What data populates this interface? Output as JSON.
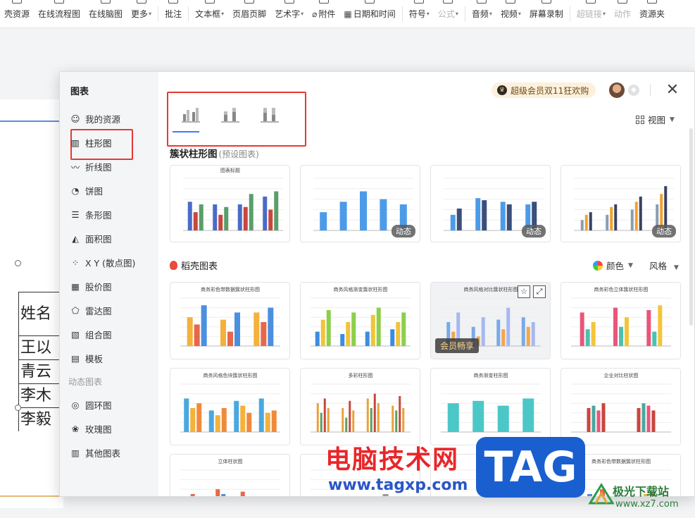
{
  "toolbar": {
    "items": [
      {
        "label": "壳资源",
        "caret": false,
        "disabled": false
      },
      {
        "label": "在线流程图",
        "caret": false,
        "disabled": false
      },
      {
        "label": "在线脑图",
        "caret": false,
        "disabled": false
      },
      {
        "label": "更多",
        "caret": true,
        "disabled": false
      },
      {
        "label": "批注",
        "caret": false,
        "disabled": false
      },
      {
        "label": "文本框",
        "caret": true,
        "disabled": false
      },
      {
        "label": "页眉页脚",
        "caret": false,
        "disabled": false
      },
      {
        "label": "艺术字",
        "caret": true,
        "disabled": false
      },
      {
        "label": "附件",
        "caret": false,
        "disabled": false
      },
      {
        "label": "日期和时间",
        "caret": false,
        "disabled": false
      },
      {
        "label": "符号",
        "caret": true,
        "disabled": false
      },
      {
        "label": "公式",
        "caret": true,
        "disabled": true
      },
      {
        "label": "音频",
        "caret": true,
        "disabled": false
      },
      {
        "label": "视频",
        "caret": true,
        "disabled": false
      },
      {
        "label": "屏幕录制",
        "caret": false,
        "disabled": false
      },
      {
        "label": "超链接",
        "caret": true,
        "disabled": true
      },
      {
        "label": "动作",
        "caret": false,
        "disabled": true
      },
      {
        "label": "资源夹",
        "caret": false,
        "disabled": false
      }
    ]
  },
  "document": {
    "table_cells": [
      "姓名",
      "王以",
      "青云",
      "李木",
      "李毅"
    ]
  },
  "dialog": {
    "title": "图表",
    "sidebar_items": [
      {
        "label": "我的资源",
        "icon": "user-icon"
      },
      {
        "label": "柱形图",
        "icon": "column-chart-icon"
      },
      {
        "label": "折线图",
        "icon": "line-chart-icon"
      },
      {
        "label": "饼图",
        "icon": "pie-chart-icon"
      },
      {
        "label": "条形图",
        "icon": "bar-chart-icon"
      },
      {
        "label": "面积图",
        "icon": "area-chart-icon"
      },
      {
        "label": "X Y (散点图)",
        "icon": "scatter-chart-icon"
      },
      {
        "label": "股价图",
        "icon": "stock-chart-icon"
      },
      {
        "label": "雷达图",
        "icon": "radar-chart-icon"
      },
      {
        "label": "组合图",
        "icon": "combo-chart-icon"
      },
      {
        "label": "模板",
        "icon": "template-icon"
      }
    ],
    "dynamic_section": "动态图表",
    "dynamic_items": [
      {
        "label": "圆环图",
        "icon": "ring-chart-icon"
      },
      {
        "label": "玫瑰图",
        "icon": "rose-chart-icon"
      },
      {
        "label": "其他图表",
        "icon": "other-chart-icon"
      }
    ],
    "promo": "超级会员双11狂欢购",
    "view_label": "视图",
    "section1_title": "簇状柱形图",
    "section1_sub": "(预设图表)",
    "section2_title": "稻壳图表",
    "color_label": "颜色",
    "style_label": "风格",
    "dynamic_badge": "动态",
    "vip_badge": "会员畅享",
    "preset_cards": [
      {
        "title": "图表标题",
        "badge": false
      },
      {
        "title": "",
        "badge": true
      },
      {
        "title": "",
        "badge": true
      },
      {
        "title": "",
        "badge": true
      }
    ],
    "docer_cards": [
      {
        "title": "商务彩色带数据簇状柱形图"
      },
      {
        "title": "商务风格渐变簇状柱形图"
      },
      {
        "title": "商务风格对比簇状柱形图"
      },
      {
        "title": "商务彩色立体簇状柱形图"
      },
      {
        "title": "商务风格色块簇状柱形图"
      },
      {
        "title": "多彩柱形图"
      },
      {
        "title": "商务渐变柱形图"
      },
      {
        "title": "企业对比柱状图"
      },
      {
        "title": "立体柱状图"
      },
      {
        "title": ""
      },
      {
        "title": ""
      },
      {
        "title": "商务彩色带数据簇状柱形图"
      }
    ]
  },
  "watermark": {
    "cn": "电脑技术网",
    "url": "www.tagxp.com",
    "tag": "TAG",
    "site_name": "极光下载站",
    "site_url": "www.xz7.com"
  }
}
